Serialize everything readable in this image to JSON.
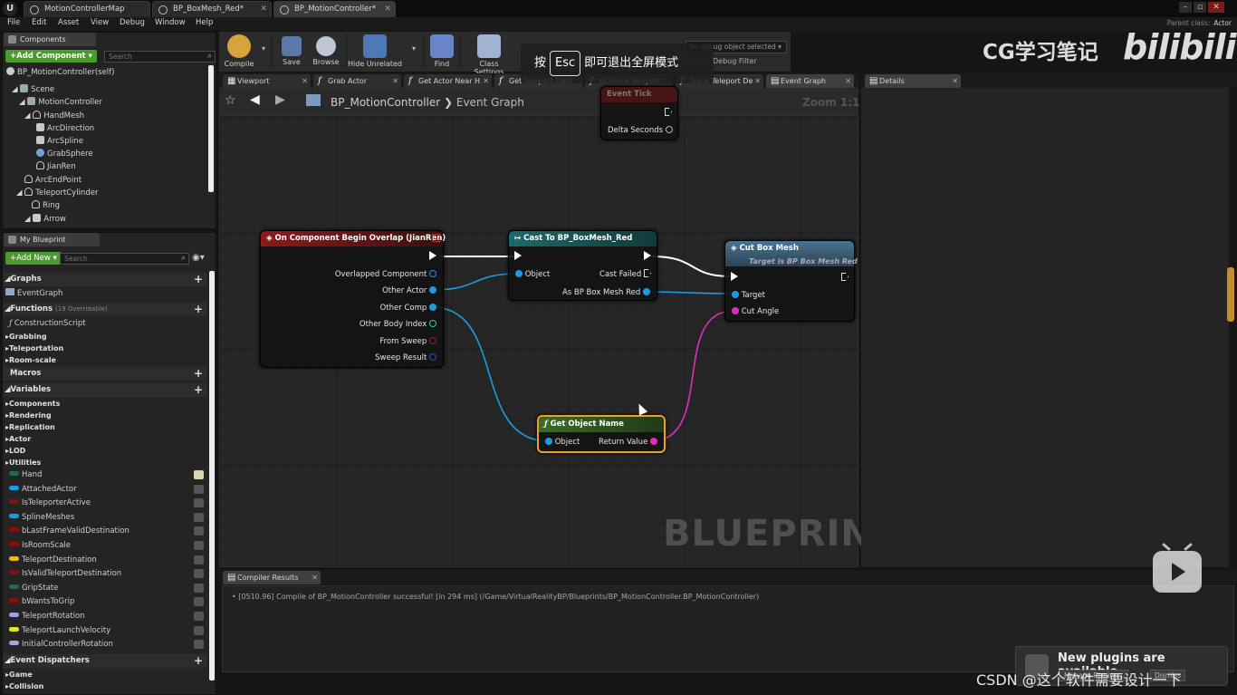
{
  "title_bar": {
    "tabs": [
      {
        "label": "MotionControllerMap"
      },
      {
        "label": "BP_BoxMesh_Red*"
      },
      {
        "label": "BP_MotionController*"
      }
    ],
    "window_buttons": [
      "–",
      "▫",
      "✕"
    ]
  },
  "menu": {
    "items": [
      "File",
      "Edit",
      "Asset",
      "View",
      "Debug",
      "Window",
      "Help"
    ],
    "parent_class_label": "Parent class:",
    "parent_class_value": "Actor"
  },
  "components_panel": {
    "tab_label": "Components",
    "add_component_label": "+Add Component ▾",
    "search_placeholder": "Search",
    "self_label": "BP_MotionController(self)",
    "tree": [
      {
        "label": "Scene"
      },
      {
        "label": "MotionController"
      },
      {
        "label": "HandMesh"
      },
      {
        "label": "ArcDirection"
      },
      {
        "label": "ArcSpline"
      },
      {
        "label": "GrabSphere"
      },
      {
        "label": "JianRen"
      },
      {
        "label": "ArcEndPoint"
      },
      {
        "label": "TeleportCylinder"
      },
      {
        "label": "Ring"
      },
      {
        "label": "Arrow"
      }
    ]
  },
  "my_blueprint": {
    "tab_label": "My Blueprint",
    "add_new_label": "+Add New ▾",
    "search_placeholder": "Search",
    "graphs_header": "Graphs",
    "event_graph_label": "EventGraph",
    "functions_header": "Functions",
    "functions_overridable": "(19 Overridable)",
    "functions": [
      "ConstructionScript",
      "Grabbing",
      "Teleportation",
      "Room-scale"
    ],
    "macros_header": "Macros",
    "variables_header": "Variables",
    "var_categories": [
      "Components",
      "Rendering",
      "Replication",
      "Actor",
      "LOD",
      "Utilities"
    ],
    "variables": [
      {
        "label": "Hand",
        "color": "#1f6b5a"
      },
      {
        "label": "AttachedActor",
        "color": "#1a9de0"
      },
      {
        "label": "IsTeleporterActive",
        "color": "#8b0f0f"
      },
      {
        "label": "SplineMeshes",
        "color": "#1a9de0"
      },
      {
        "label": "bLastFrameValidDestination",
        "color": "#8b0f0f"
      },
      {
        "label": "IsRoomScale",
        "color": "#8b0f0f"
      },
      {
        "label": "TeleportDestination",
        "color": "#e8b72a"
      },
      {
        "label": "IsValidTeleportDestination",
        "color": "#8b0f0f"
      },
      {
        "label": "GripState",
        "color": "#1f6b5a"
      },
      {
        "label": "bWantsToGrip",
        "color": "#8b0f0f"
      },
      {
        "label": "TeleportRotation",
        "color": "#9aa6e6"
      },
      {
        "label": "TeleportLaunchVelocity",
        "color": "#e8e82a"
      },
      {
        "label": "InitialControllerRotation",
        "color": "#9aa6e6"
      }
    ],
    "event_dispatchers_header": "Event Dispatchers",
    "dispatcher_categories": [
      "Game",
      "Collision"
    ]
  },
  "toolbar": {
    "buttons": [
      "Compile",
      "Save",
      "Browse",
      "Hide Unrelated",
      "Find",
      "Class Settings"
    ],
    "debug_select": "No debug object selected ▾",
    "debug_filter": "Debug Filter"
  },
  "graph_tabs": [
    {
      "label": "Viewport",
      "icon": "viewport-icon"
    },
    {
      "label": "Grab Actor",
      "icon": "function-icon"
    },
    {
      "label": "Get Actor Near H",
      "icon": "function-icon"
    },
    {
      "label": "Get Teleport Dest",
      "icon": "function-icon"
    },
    {
      "label": "Activate Teleport",
      "icon": "function-icon"
    },
    {
      "label": "Trace Teleport De",
      "icon": "function-icon"
    },
    {
      "label": "Event Graph",
      "icon": "graph-icon"
    }
  ],
  "graph": {
    "breadcrumb_root": "BP_MotionController",
    "breadcrumb_leaf": "Event Graph",
    "zoom": "Zoom 1:1",
    "watermark": "BLUEPRINT",
    "nodes": {
      "event_tick": {
        "title": "Event Tick",
        "pin": "Delta Seconds"
      },
      "overlap": {
        "title": "On Component Begin Overlap (JianRen)",
        "pins": [
          "Overlapped Component",
          "Other Actor",
          "Other Comp",
          "Other Body Index",
          "From Sweep",
          "Sweep Result"
        ]
      },
      "cast": {
        "title": "Cast To BP_BoxMesh_Red",
        "in_pin": "Object",
        "fail_pin": "Cast Failed",
        "out_pin": "As BP Box Mesh Red"
      },
      "cut": {
        "title": "Cut Box Mesh",
        "subtitle": "Target is BP Box Mesh Red",
        "pins": [
          "Target",
          "Cut Angle"
        ]
      },
      "get_name": {
        "title": "Get Object Name",
        "in_pin": "Object",
        "out_pin": "Return Value"
      }
    }
  },
  "details": {
    "tab_label": "Details"
  },
  "compiler": {
    "tab_label": "Compiler Results",
    "line": "[0510.96] Compile of BP_MotionController successful! [in 294 ms] (/Game/VirtualRealityBP/Blueprints/BP_MotionController.BP_MotionController)"
  },
  "overlays": {
    "esc_prefix": "按",
    "esc_key": "Esc",
    "esc_suffix": "即可退出全屏模式",
    "cg_watermark": "CG学习笔记",
    "bili_watermark": "bilibili",
    "plugins_title": "New plugins are available",
    "plugins_manage": "Manage Plugins...",
    "plugins_dismiss": "Dismiss",
    "csdn_watermark": "CSDN @这个软件需要设计一下"
  }
}
